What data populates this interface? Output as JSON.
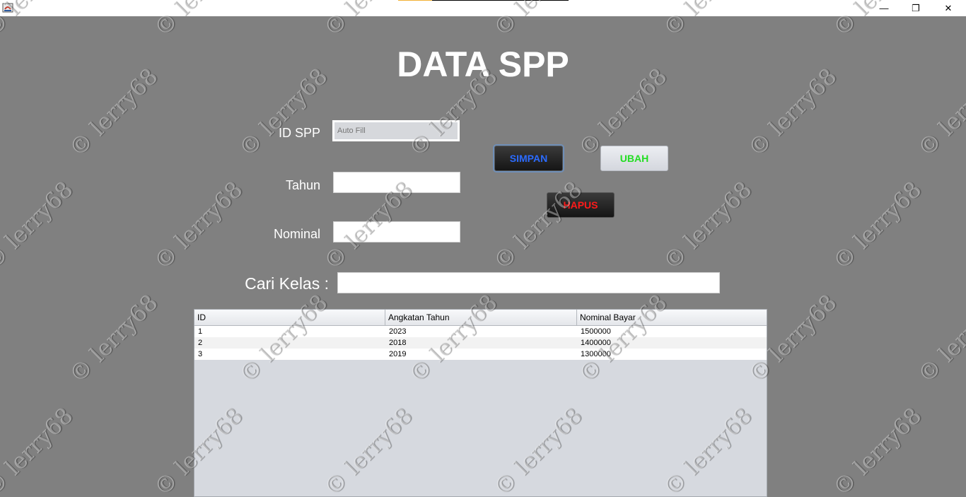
{
  "window": {
    "minimize_glyph": "—",
    "maximize_glyph": "❐",
    "close_glyph": "✕"
  },
  "page": {
    "title": "DATA SPP"
  },
  "form": {
    "id_label": "ID SPP",
    "id_placeholder": "Auto Fill",
    "tahun_label": "Tahun",
    "tahun_value": "",
    "nominal_label": "Nominal",
    "nominal_value": ""
  },
  "buttons": {
    "simpan": {
      "label": "SIMPAN",
      "color": "#2b6bff"
    },
    "ubah": {
      "label": "UBAH",
      "color": "#22dd22"
    },
    "hapus": {
      "label": "HAPUS",
      "color": "#ff1a1a"
    }
  },
  "search": {
    "label": "Cari Kelas :",
    "value": ""
  },
  "table": {
    "columns": [
      "ID",
      "Angkatan Tahun",
      "Nominal Bayar"
    ],
    "rows": [
      [
        "1",
        "2023",
        "1500000"
      ],
      [
        "2",
        "2018",
        "1400000"
      ],
      [
        "3",
        "2019",
        "1300000"
      ]
    ]
  },
  "watermark": {
    "text": "© lerry68"
  },
  "colors": {
    "background": "#808080",
    "table_empty": "#d6d9df"
  }
}
